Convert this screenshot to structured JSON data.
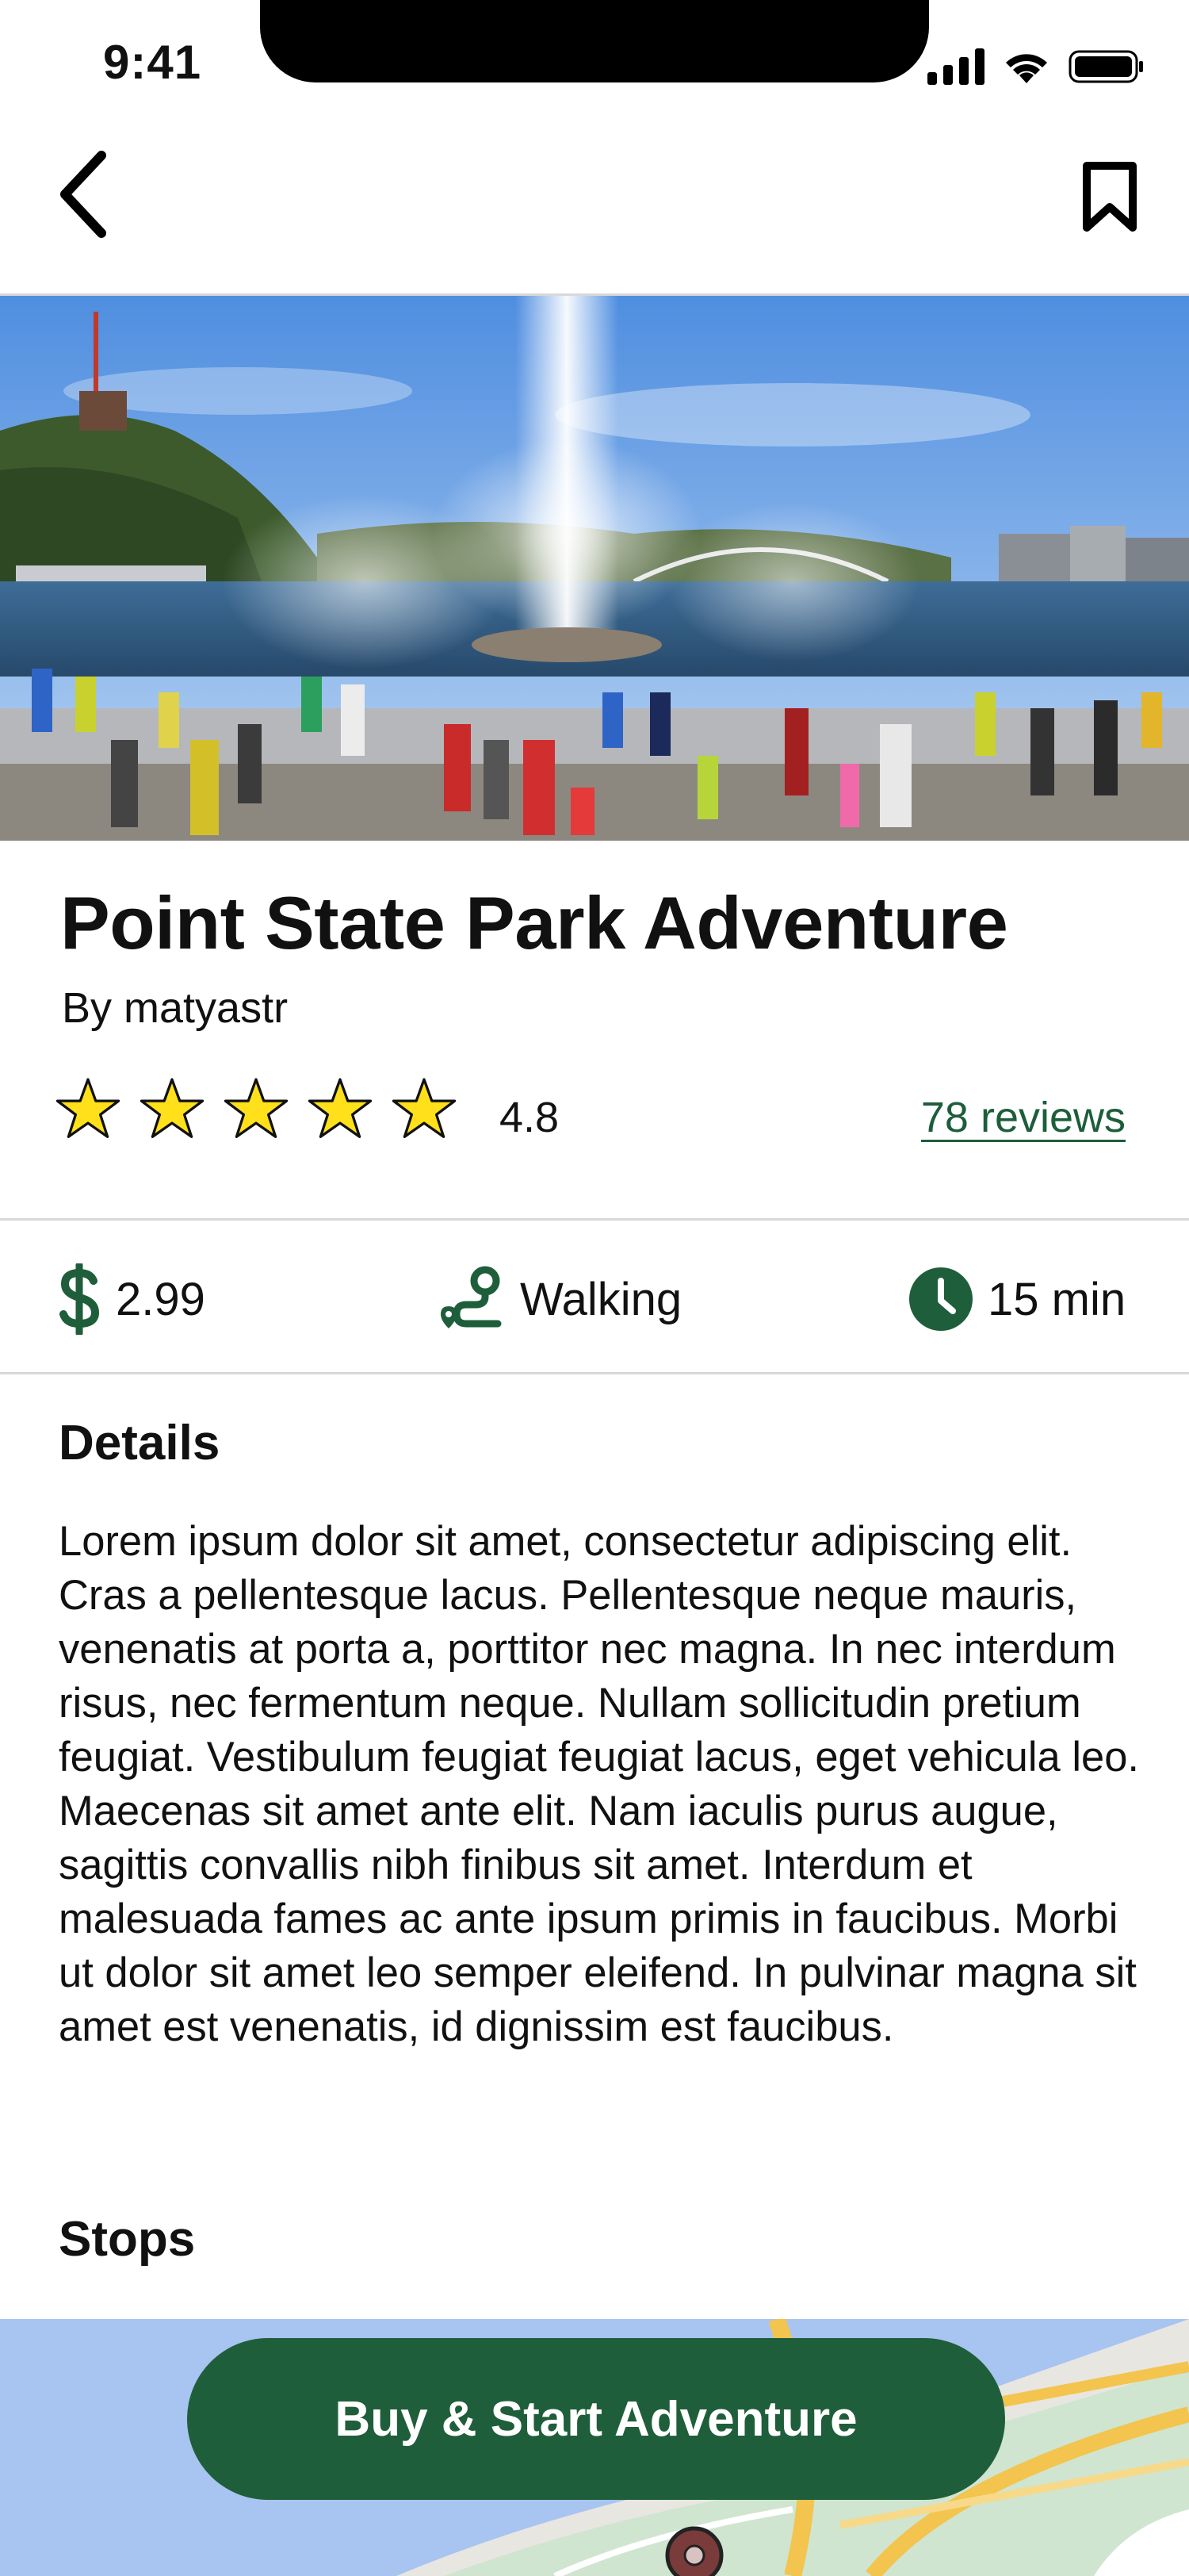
{
  "status_bar": {
    "time": "9:41"
  },
  "tour": {
    "title": "Point State Park Adventure",
    "author": "By matyastr",
    "rating": "4.8",
    "stars_filled": 5,
    "reviews_link": "78 reviews"
  },
  "info": {
    "price": "2.99",
    "mode": "Walking",
    "duration": "15 min"
  },
  "details": {
    "heading": "Details",
    "body": "Lorem ipsum dolor sit amet, consectetur adipiscing elit. Cras a pellentesque lacus. Pellentesque neque mauris, venenatis at porta a, porttitor nec magna. In nec interdum risus, nec fermentum neque. Nullam sollicitudin pretium feugiat. Vestibulum feugiat feugiat lacus, eget vehicula leo. Maecenas sit amet ante elit. Nam iaculis purus augue, sagittis convallis nibh finibus sit amet. Interdum et malesuada fames ac ante ipsum primis in faucibus. Morbi ut dolor sit amet leo semper eleifend. In pulvinar magna sit amet est venenatis, id dignissim est faucibus."
  },
  "stops": {
    "heading": "Stops"
  },
  "cta": {
    "label": "Buy & Start Adventure"
  },
  "icons": {
    "back": "chevron-left-icon",
    "bookmark": "bookmark-icon",
    "star": "star-icon",
    "price": "dollar-icon",
    "mode": "route-icon",
    "duration": "clock-icon",
    "map_pin": "map-pin-icon"
  },
  "colors": {
    "accent": "#1f5e3a",
    "link": "#1d5e3a",
    "star_fill": "#ffe01a",
    "divider": "#d8d8d8"
  }
}
